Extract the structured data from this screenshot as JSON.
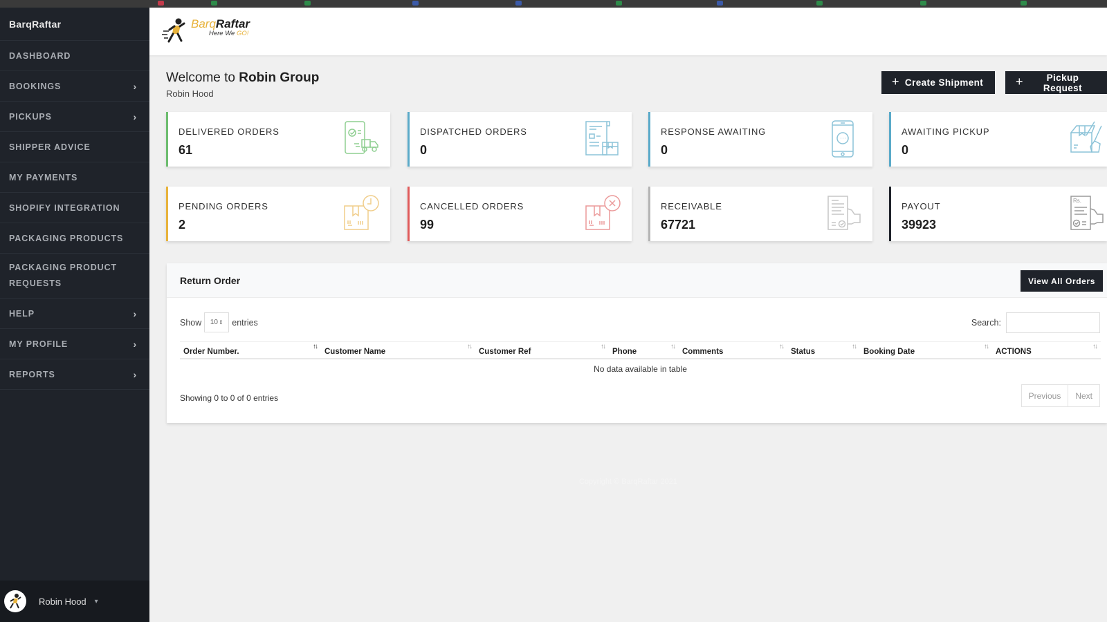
{
  "sidebar": {
    "brand": "BarqRaftar",
    "items": [
      {
        "label": "DASHBOARD",
        "has_submenu": false
      },
      {
        "label": "BOOKINGS",
        "has_submenu": true
      },
      {
        "label": "PICKUPS",
        "has_submenu": true
      },
      {
        "label": "SHIPPER ADVICE",
        "has_submenu": false
      },
      {
        "label": "MY PAYMENTS",
        "has_submenu": false
      },
      {
        "label": "SHOPIFY INTEGRATION",
        "has_submenu": false
      },
      {
        "label": "PACKAGING PRODUCTS",
        "has_submenu": false
      },
      {
        "label": "PACKAGING PRODUCT REQUESTS",
        "has_submenu": false
      },
      {
        "label": "HELP",
        "has_submenu": true
      },
      {
        "label": "MY PROFILE",
        "has_submenu": true
      },
      {
        "label": "REPORTS",
        "has_submenu": true
      }
    ],
    "chevron": "›",
    "user": {
      "name": "Robin Hood",
      "caret": "▾"
    }
  },
  "header": {
    "logo": {
      "barq": "Barq",
      "raftar": "Raftar",
      "tagline_a": "Here We ",
      "tagline_b": "GO!"
    }
  },
  "welcome": {
    "prefix": "Welcome to ",
    "company": "Robin Group",
    "user": "Robin Hood"
  },
  "actions": {
    "create_shipment": "Create Shipment",
    "pickup_request": "Pickup Request",
    "plus": "+"
  },
  "stats": [
    {
      "label": "DELIVERED ORDERS",
      "value": "61",
      "color": "#6dbd6f",
      "icon": "delivery-truck-icon"
    },
    {
      "label": "DISPATCHED ORDERS",
      "value": "0",
      "color": "#5aaac9",
      "icon": "dispatch-document-icon"
    },
    {
      "label": "RESPONSE AWAITING",
      "value": "0",
      "color": "#5aaac9",
      "icon": "phone-chat-icon"
    },
    {
      "label": "AWAITING PICKUP",
      "value": "0",
      "color": "#5aaac9",
      "icon": "box-hand-icon"
    },
    {
      "label": "PENDING ORDERS",
      "value": "2",
      "color": "#e8b33c",
      "icon": "box-clock-icon"
    },
    {
      "label": "CANCELLED ORDERS",
      "value": "99",
      "color": "#e05a5a",
      "icon": "box-cancel-icon"
    },
    {
      "label": "RECEIVABLE",
      "value": "67721",
      "color": "#b5b5b5",
      "icon": "invoice-hand-icon"
    },
    {
      "label": "PAYOUT",
      "value": "39923",
      "color": "#1f232a",
      "icon": "payout-receipt-icon"
    }
  ],
  "return_order": {
    "title": "Return Order",
    "view_all": "View All Orders",
    "show_label": "Show",
    "entries_label": "entries",
    "page_size": "10",
    "search_label": "Search:",
    "search_value": "",
    "columns": [
      "Order Number.",
      "Customer Name",
      "Customer Ref",
      "Phone",
      "Comments",
      "Status",
      "Booking Date",
      "ACTIONS"
    ],
    "sort_glyph": "↑↓",
    "rows": [],
    "empty_text": "No data available in table",
    "info": "Showing 0 to 0 of 0 entries",
    "prev": "Previous",
    "next": "Next"
  },
  "footer": "Copyright © BarqRaftar 2021"
}
